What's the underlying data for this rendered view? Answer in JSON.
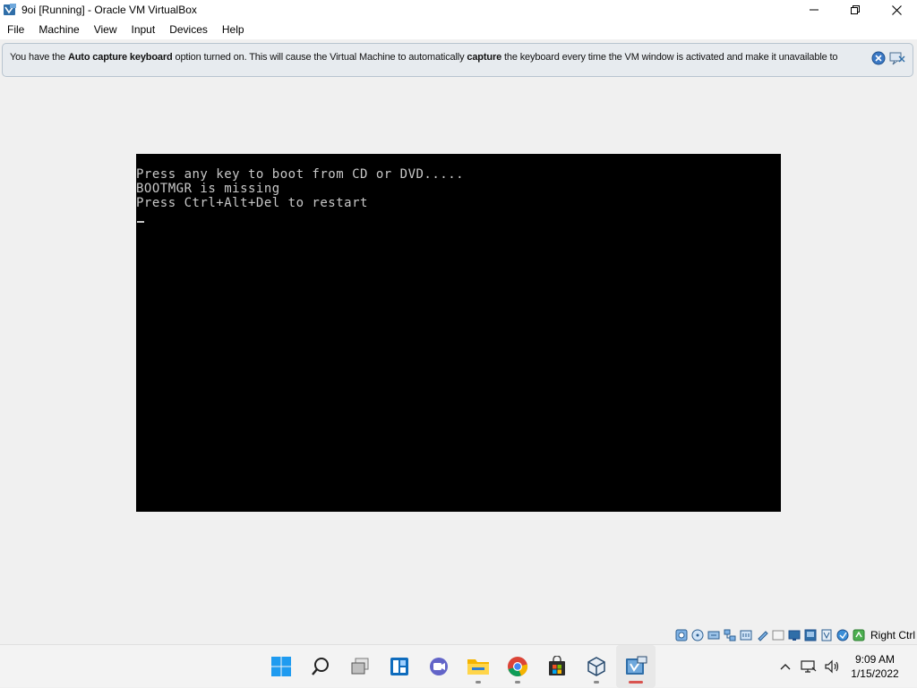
{
  "window": {
    "title": "9oi [Running] - Oracle VM VirtualBox",
    "app_icon": "virtualbox-icon",
    "controls": [
      "minimize-icon",
      "restore-icon",
      "close-icon"
    ]
  },
  "menubar": {
    "items": [
      {
        "label": "File"
      },
      {
        "label": "Machine"
      },
      {
        "label": "View"
      },
      {
        "label": "Input"
      },
      {
        "label": "Devices"
      },
      {
        "label": "Help"
      }
    ]
  },
  "notice": {
    "t1": "You have the ",
    "b1": "Auto capture keyboard",
    "t2": " option turned on. This will cause the Virtual Machine to automatically ",
    "b2": "capture",
    "t3": " the keyboard every time the VM window is activated and make it unavailable to",
    "icons": [
      "info-icon",
      "close-message-icon"
    ]
  },
  "vm_screen": {
    "background": "#000000",
    "text_color": "#c8c8c8",
    "lines": [
      "Press any key to boot from CD or DVD.....",
      "BOOTMGR is missing",
      "Press Ctrl+Alt+Del to restart"
    ]
  },
  "statusbar": {
    "icons": [
      "hard-disk-icon",
      "optical-drive-icon",
      "audio-icon",
      "network-icon",
      "usb-icon",
      "shared-folders-icon",
      "display-icon",
      "video-capture-icon",
      "mouse-integration-icon",
      "cpu-icon",
      "keyboard-capture-icon"
    ],
    "host_key": "Right Ctrl"
  },
  "taskbar": {
    "apps": [
      {
        "name": "start-icon"
      },
      {
        "name": "search-icon"
      },
      {
        "name": "task-view-icon"
      },
      {
        "name": "widgets-icon"
      },
      {
        "name": "chat-icon"
      },
      {
        "name": "file-explorer-icon"
      },
      {
        "name": "chrome-icon"
      },
      {
        "name": "store-icon"
      },
      {
        "name": "virtualbox-manager-icon"
      },
      {
        "name": "virtualbox-vm-icon",
        "active": true
      }
    ],
    "tray": {
      "icons": [
        "chevron-up-icon",
        "network-icon",
        "volume-icon"
      ],
      "time": "9:09 AM",
      "date": "1/15/2022"
    }
  }
}
